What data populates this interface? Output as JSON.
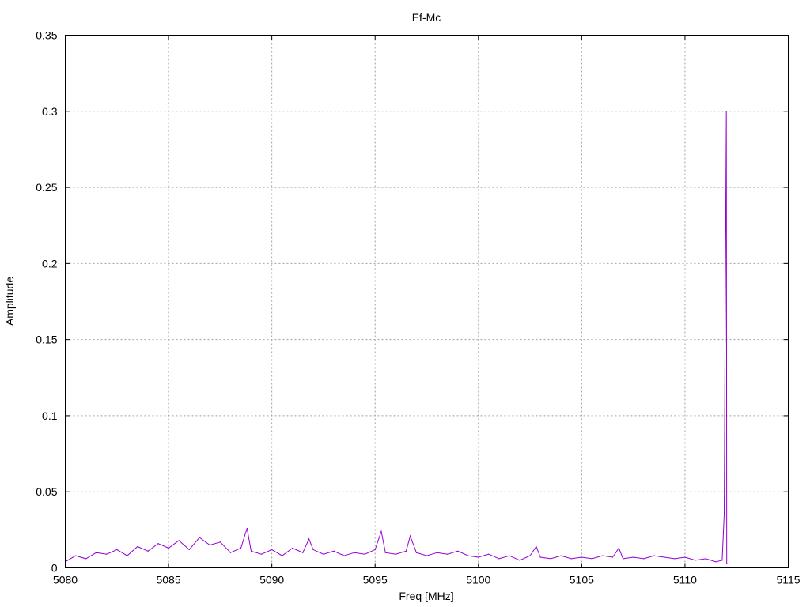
{
  "chart_data": {
    "type": "line",
    "title": "Ef-Mc",
    "xlabel": "Freq [MHz]",
    "ylabel": "Amplitude",
    "xlim": [
      5080,
      5115
    ],
    "ylim": [
      0,
      0.35
    ],
    "xticks": [
      "5080",
      "5085",
      "5090",
      "5095",
      "5100",
      "5105",
      "5110",
      "5115"
    ],
    "yticks": [
      "0",
      "0.05",
      "0.1",
      "0.15",
      "0.2",
      "0.25",
      "0.3",
      "0.35"
    ],
    "grid": true,
    "legend": "none",
    "series_color": "#9400d3",
    "series": [
      {
        "x": [
          5080.0,
          5080.5,
          5081.0,
          5081.5,
          5082.0,
          5082.5,
          5083.0,
          5083.5,
          5084.0,
          5084.5,
          5085.0,
          5085.5,
          5086.0,
          5086.5,
          5087.0,
          5087.5,
          5088.0,
          5088.5,
          5088.8,
          5089.0,
          5089.5,
          5090.0,
          5090.5,
          5091.0,
          5091.5,
          5091.8,
          5092.0,
          5092.5,
          5093.0,
          5093.5,
          5094.0,
          5094.5,
          5095.0,
          5095.3,
          5095.5,
          5096.0,
          5096.5,
          5096.7,
          5097.0,
          5097.5,
          5098.0,
          5098.5,
          5099.0,
          5099.5,
          5100.0,
          5100.5,
          5101.0,
          5101.5,
          5102.0,
          5102.5,
          5102.8,
          5103.0,
          5103.5,
          5104.0,
          5104.5,
          5105.0,
          5105.5,
          5106.0,
          5106.5,
          5106.8,
          5107.0,
          5107.5,
          5108.0,
          5108.5,
          5109.0,
          5109.5,
          5110.0,
          5110.5,
          5111.0,
          5111.5,
          5111.8,
          5111.9,
          5111.95,
          5112.0,
          5112.02
        ],
        "y": [
          0.004,
          0.008,
          0.006,
          0.01,
          0.009,
          0.012,
          0.008,
          0.014,
          0.011,
          0.016,
          0.013,
          0.018,
          0.012,
          0.02,
          0.015,
          0.017,
          0.01,
          0.013,
          0.026,
          0.011,
          0.009,
          0.012,
          0.008,
          0.013,
          0.01,
          0.019,
          0.012,
          0.009,
          0.011,
          0.008,
          0.01,
          0.009,
          0.012,
          0.024,
          0.01,
          0.009,
          0.011,
          0.021,
          0.01,
          0.008,
          0.01,
          0.009,
          0.011,
          0.008,
          0.007,
          0.009,
          0.006,
          0.008,
          0.005,
          0.008,
          0.014,
          0.007,
          0.006,
          0.008,
          0.006,
          0.007,
          0.006,
          0.008,
          0.007,
          0.013,
          0.006,
          0.007,
          0.006,
          0.008,
          0.007,
          0.006,
          0.007,
          0.005,
          0.006,
          0.004,
          0.005,
          0.035,
          0.185,
          0.3,
          0.003
        ]
      }
    ]
  }
}
